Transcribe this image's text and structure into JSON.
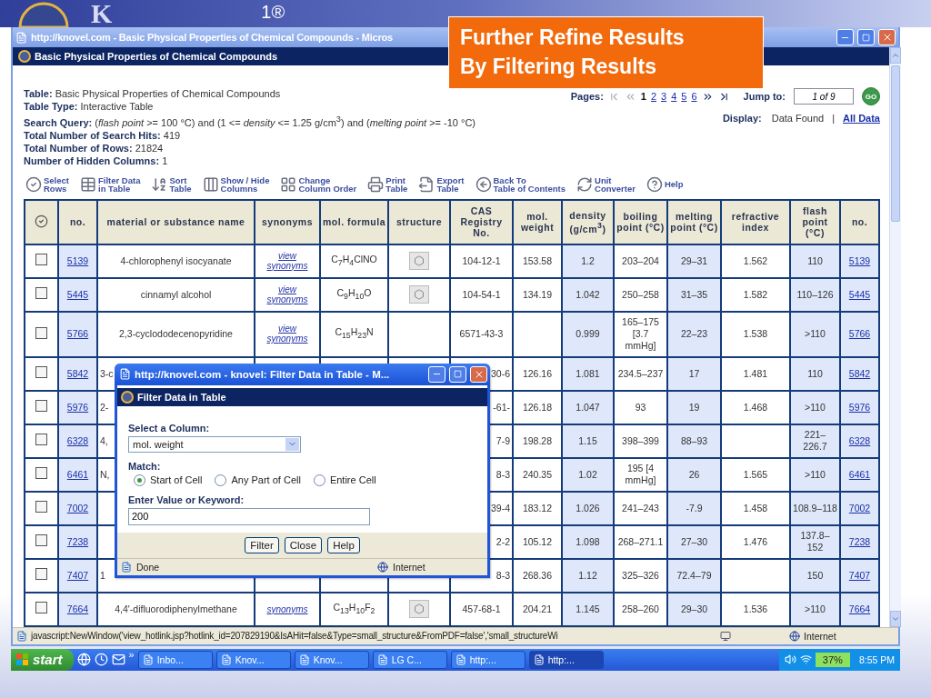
{
  "slide": {
    "logo_letter": "K",
    "logo_mark": "1®",
    "callout_lines": [
      "Further Refine Results",
      "By Filtering Results"
    ]
  },
  "browser": {
    "title": "http://knovel.com - Basic Physical Properties of Chemical Compounds - Micros",
    "page_title": "Basic Physical Properties of Chemical Compounds",
    "info": [
      {
        "label": "Table:",
        "value": "Basic Physical Properties of Chemical Compounds"
      },
      {
        "label": "Table Type:",
        "value": "Interactive Table"
      },
      {
        "label": "Search Query:",
        "value": "(*flash point* >= 100 °C) and (1 <= *density* <= 1.25 g/cm$^{3}$) and (*melting point* >= -10 °C)"
      },
      {
        "label": "Total Number of Search Hits:",
        "value": "419"
      },
      {
        "label": "Total Number of Rows:",
        "value": "21824"
      },
      {
        "label": "Number of Hidden Columns:",
        "value": "1"
      }
    ],
    "pager": {
      "label": "Pages:",
      "first": {
        "disabled": true
      },
      "prev": {
        "disabled": true
      },
      "pages": [
        {
          "label": "1",
          "selected": true
        },
        {
          "label": "2",
          "selected": false
        },
        {
          "label": "3",
          "selected": false
        },
        {
          "label": "4",
          "selected": false
        },
        {
          "label": "5",
          "selected": false
        },
        {
          "label": "6",
          "selected": false
        }
      ],
      "next": {
        "disabled": false
      },
      "last": {
        "disabled": false
      },
      "jump_label": "Jump to:",
      "jump_value": "1 of 9",
      "go": "GO"
    },
    "display": {
      "label": "Display:",
      "separator": "|",
      "options": [
        {
          "label": "Data Found",
          "selected": true
        },
        {
          "label": "All Data",
          "selected": false
        }
      ]
    },
    "toolbar": [
      {
        "kind": "select",
        "lines": [
          "Select",
          "Rows"
        ]
      },
      {
        "kind": "filter",
        "lines": [
          "Filter Data",
          "in Table"
        ]
      },
      {
        "kind": "sort",
        "lines": [
          "Sort",
          "Table"
        ]
      },
      {
        "kind": "columns",
        "lines": [
          "Show / Hide",
          "Columns"
        ]
      },
      {
        "kind": "order",
        "lines": [
          "Change",
          "Column Order"
        ]
      },
      {
        "kind": "print",
        "lines": [
          "Print",
          "Table"
        ]
      },
      {
        "kind": "export",
        "lines": [
          "Export",
          "Table"
        ]
      },
      {
        "kind": "back",
        "lines": [
          "Back To",
          "Table of Contents"
        ]
      },
      {
        "kind": "convert",
        "lines": [
          "Unit",
          "Converter"
        ]
      },
      {
        "kind": "help",
        "lines": [
          "Help"
        ]
      }
    ],
    "table": {
      "columns": [
        "no.",
        "material or substance name",
        "synonyms",
        "mol. formula",
        "structure",
        "CAS Registry No.",
        "mol. weight",
        "density (g/cm$^{3}$)",
        "boiling point (°C)",
        "melting point (°C)",
        "refractive index",
        "flash point (°C)",
        "no."
      ],
      "rows": [
        {
          "kind": "full",
          "checked": false,
          "no": "5139",
          "name": "4-chlorophenyl isocyanate",
          "synonyms": "view synonyms",
          "formula": "C$_{7}$H$_{4}$ClNO",
          "structure": true,
          "cas": "104-12-1",
          "weight": "153.58",
          "density": "1.2",
          "boiling": "203–204",
          "melting": "29–31",
          "refractive": "1.562",
          "flash": "110",
          "no_end": "5139"
        },
        {
          "kind": "full",
          "checked": false,
          "no": "5445",
          "name": "cinnamyl alcohol",
          "synonyms": "view synonyms",
          "formula": "C$_{9}$H$_{10}$O",
          "structure": true,
          "cas": "104-54-1",
          "weight": "134.19",
          "density": "1.042",
          "boiling": "250–258",
          "melting": "31–35",
          "refractive": "1.582",
          "flash": "110–126",
          "no_end": "5445"
        },
        {
          "kind": "full",
          "checked": false,
          "no": "5766",
          "name": "2,3-cyclododecenopyridine",
          "synonyms": "view synonyms",
          "formula": "C$_{15}$H$_{23}$N",
          "structure": false,
          "cas": "6571-43-3",
          "density": "0.999",
          "boiling": "165–175 [3.7 mmHg]",
          "melting": "22–23",
          "refractive": "1.538",
          "flash": ">110",
          "no_end": "5766"
        },
        {
          "kind": "covered",
          "checked": false,
          "no": "5842",
          "name": "3-c",
          "cas": "30-6",
          "weight": "126.16",
          "density": "1.081",
          "boiling": "234.5–237",
          "melting": "17",
          "refractive": "1.481",
          "flash": "110",
          "no_end": "5842"
        },
        {
          "kind": "covered",
          "checked": false,
          "no": "5976",
          "name": "2-",
          "cas": "-61-",
          "weight": "126.18",
          "density": "1.047",
          "boiling": "93",
          "melting": "19",
          "refractive": "1.468",
          "flash": ">110",
          "no_end": "5976"
        },
        {
          "kind": "covered",
          "checked": false,
          "no": "6328",
          "name": "4,",
          "cas": "7-9",
          "weight": "198.28",
          "density": "1.15",
          "boiling": "398–399",
          "melting": "88–93",
          "flash": "221–226.7",
          "no_end": "6328"
        },
        {
          "kind": "covered",
          "checked": false,
          "no": "6461",
          "name": "N,",
          "cas": "8-3",
          "weight": "240.35",
          "density": "1.02",
          "boiling": "195 [4 mmHg]",
          "melting": "26",
          "refractive": "1.565",
          "flash": ">110",
          "no_end": "6461"
        },
        {
          "kind": "covered",
          "checked": false,
          "no": "7002",
          "cas": "39-4",
          "weight": "183.12",
          "density": "1.026",
          "boiling": "241–243",
          "melting": "-7.9",
          "refractive": "1.458",
          "flash": "108.9–118",
          "no_end": "7002"
        },
        {
          "kind": "covered",
          "checked": false,
          "no": "7238",
          "cas": "2-2",
          "weight": "105.12",
          "density": "1.098",
          "boiling": "268–271.1",
          "melting": "27–30",
          "refractive": "1.476",
          "flash": "137.8–152",
          "no_end": "7238"
        },
        {
          "kind": "covered",
          "checked": false,
          "no": "7407",
          "name": "1",
          "cas": "8-3",
          "weight": "268.36",
          "density": "1.12",
          "boiling": "325–326",
          "melting": "72.4–79",
          "flash": "150",
          "no_end": "7407"
        },
        {
          "kind": "full",
          "checked": false,
          "no": "7664",
          "name": "4,4'-difluorodiphenylmethane",
          "synonyms": "synonyms",
          "formula": "C$_{13}$H$_{10}$F$_{2}$",
          "structure": true,
          "cas": "457-68-1",
          "weight": "204.21",
          "density": "1.145",
          "boiling": "258–260",
          "melting": "29–30",
          "refractive": "1.536",
          "flash": ">110",
          "no_end": "7664"
        }
      ]
    },
    "dialog": {
      "title": "http://knovel.com - knovel: Filter Data in Table - M...",
      "header": "Filter Data in Table",
      "select_label": "Select a Column:",
      "select_value": "mol. weight",
      "match_label": "Match:",
      "match_options": [
        {
          "label": "Start of Cell",
          "selected": true
        },
        {
          "label": "Any Part of Cell",
          "selected": false
        },
        {
          "label": "Entire Cell",
          "selected": false
        }
      ],
      "value_label": "Enter Value or Keyword:",
      "value": "200",
      "buttons": [
        "Filter",
        "Close",
        "Help"
      ],
      "status": "Done",
      "zone": "Internet"
    },
    "status": {
      "text": "javascript:NewWindow('view_hotlink.jsp?hotlink_id=207829190&IsAHit=false&Type=small_structure&FromPDF=false','small_structureWi",
      "zone": "Internet"
    }
  },
  "taskbar": {
    "start": "start",
    "more": "»",
    "tasks": [
      {
        "label": "Inbo...",
        "selected": false
      },
      {
        "label": "Knov...",
        "selected": false
      },
      {
        "label": "Knov...",
        "selected": false
      },
      {
        "label": "LG C...",
        "selected": false
      },
      {
        "label": "http:...",
        "selected": false
      },
      {
        "label": "http:...",
        "selected": true
      }
    ],
    "battery": "37%",
    "time": "8:55 PM"
  }
}
